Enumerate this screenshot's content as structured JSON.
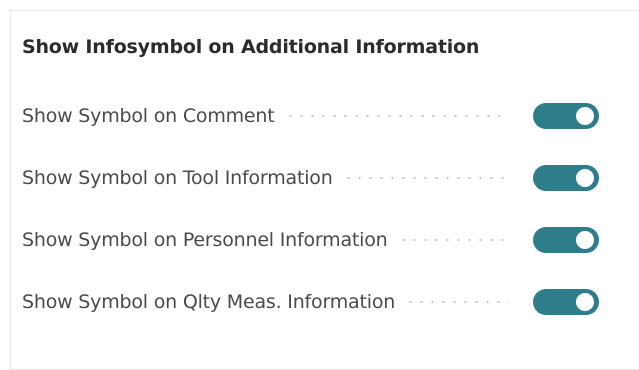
{
  "section": {
    "title": "Show Infosymbol on Additional Information"
  },
  "rows": [
    {
      "label": "Show Symbol on Comment",
      "toggle_on": true
    },
    {
      "label": "Show Symbol on Tool Information",
      "toggle_on": true
    },
    {
      "label": "Show Symbol on Personnel Information",
      "toggle_on": true
    },
    {
      "label": "Show Symbol on Qlty Meas. Information",
      "toggle_on": true
    }
  ],
  "colors": {
    "toggle_on": "#2e7d8a",
    "title_text": "#2b2b2b",
    "label_text": "#4a4a4a"
  }
}
